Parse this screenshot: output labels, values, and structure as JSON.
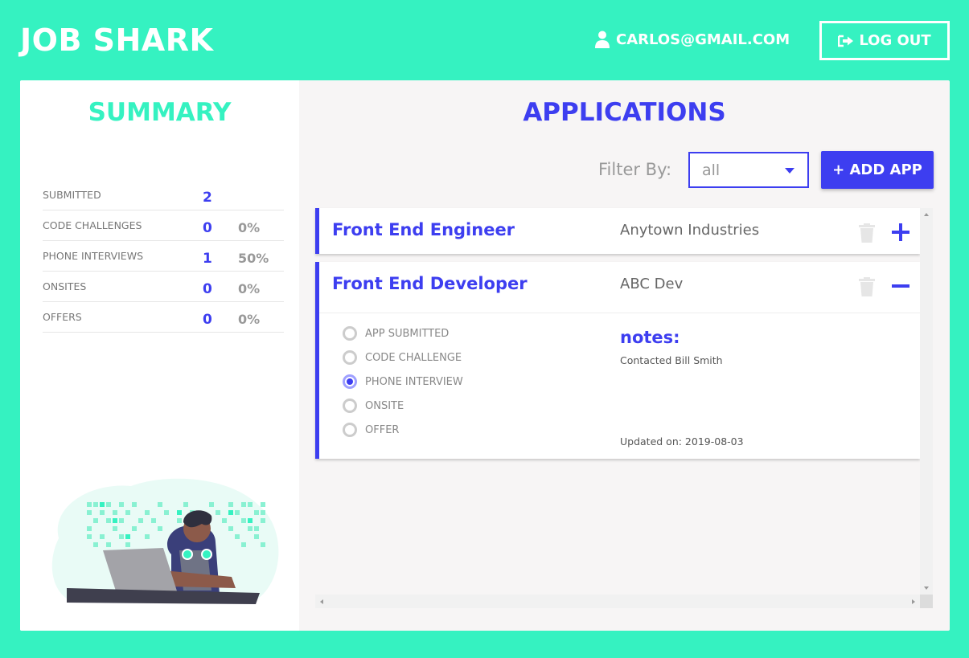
{
  "header": {
    "brand": "JOB SHARK",
    "user_email": "CARLOS@GMAIL.COM",
    "logout_label": "LOG OUT"
  },
  "summary": {
    "title": "SUMMARY",
    "stats": [
      {
        "label": "SUBMITTED",
        "count": "2",
        "percent": ""
      },
      {
        "label": "CODE CHALLENGES",
        "count": "0",
        "percent": "0%"
      },
      {
        "label": "PHONE INTERVIEWS",
        "count": "1",
        "percent": "50%"
      },
      {
        "label": "ONSITES",
        "count": "0",
        "percent": "0%"
      },
      {
        "label": "OFFERS",
        "count": "0",
        "percent": "0%"
      }
    ]
  },
  "applications": {
    "title": "APPLICATIONS",
    "filter_label": "Filter By:",
    "filter_value": "all",
    "add_label": "+ ADD APP",
    "items": [
      {
        "title": "Front End Engineer",
        "company": "Anytown Industries",
        "expanded": false
      },
      {
        "title": "Front End Developer",
        "company": "ABC Dev",
        "expanded": true,
        "stages": [
          "APP SUBMITTED",
          "CODE CHALLENGE",
          "PHONE INTERVIEW",
          "ONSITE",
          "OFFER"
        ],
        "current_stage": "PHONE INTERVIEW",
        "notes_label": "notes:",
        "notes": "Contacted Bill Smith",
        "updated": "Updated on: 2019-08-03"
      }
    ]
  },
  "colors": {
    "accent_teal": "#35f2c1",
    "accent_blue": "#3d3ef0"
  },
  "icons": {
    "user": "user-icon",
    "logout": "sign-out-icon",
    "trash": "trash-icon",
    "expand": "plus-icon",
    "collapse": "minus-icon"
  }
}
